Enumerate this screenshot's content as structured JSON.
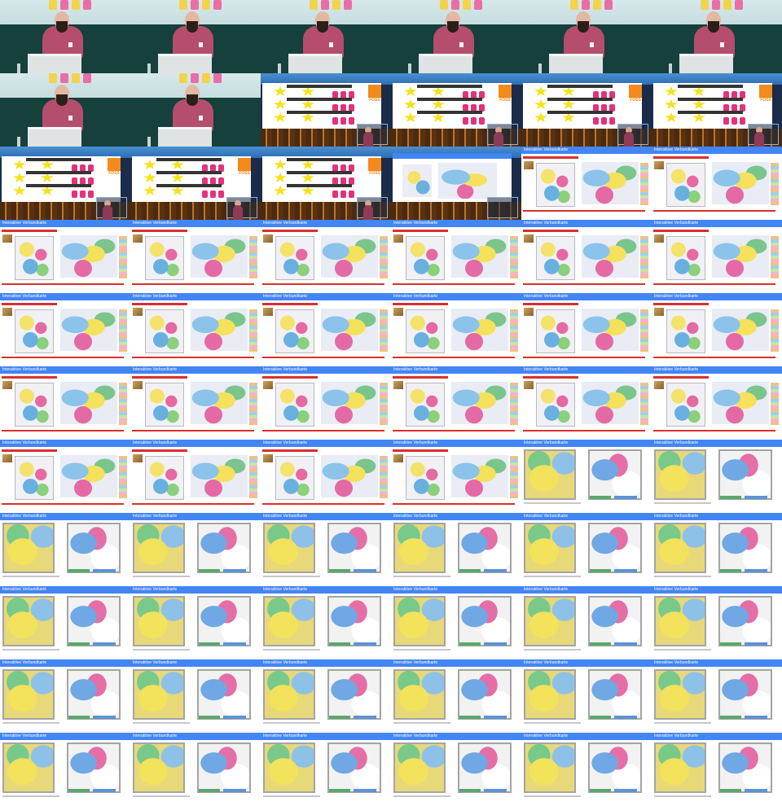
{
  "sheet": {
    "columns": 6,
    "rows": 11,
    "browser_window_title": "Interaktive Verbundkarte",
    "slide_logo_text": "FOSS",
    "frames": [
      "speaker",
      "speaker",
      "speaker",
      "speaker",
      "speaker",
      "speaker",
      "speaker",
      "speaker",
      "title",
      "title",
      "title",
      "title",
      "title",
      "title",
      "title",
      "transition",
      "browser",
      "browser",
      "browser",
      "browser",
      "browser",
      "browser",
      "browser",
      "browser",
      "browser",
      "browser",
      "browser",
      "browser",
      "browser",
      "browser",
      "browser",
      "browser",
      "browser",
      "browser",
      "browser",
      "browser",
      "browser",
      "browser",
      "browser",
      "browser",
      "zoom",
      "zoom",
      "zoom",
      "zoom",
      "zoom",
      "zoom",
      "zoom",
      "zoom",
      "zoom",
      "zoom",
      "zoom",
      "zoom",
      "zoom",
      "zoom",
      "zoom",
      "zoom",
      "zoom",
      "zoom",
      "zoom",
      "zoom",
      "zoom",
      "zoom",
      "zoom",
      "zoom",
      "zoom",
      "zoom"
    ]
  }
}
